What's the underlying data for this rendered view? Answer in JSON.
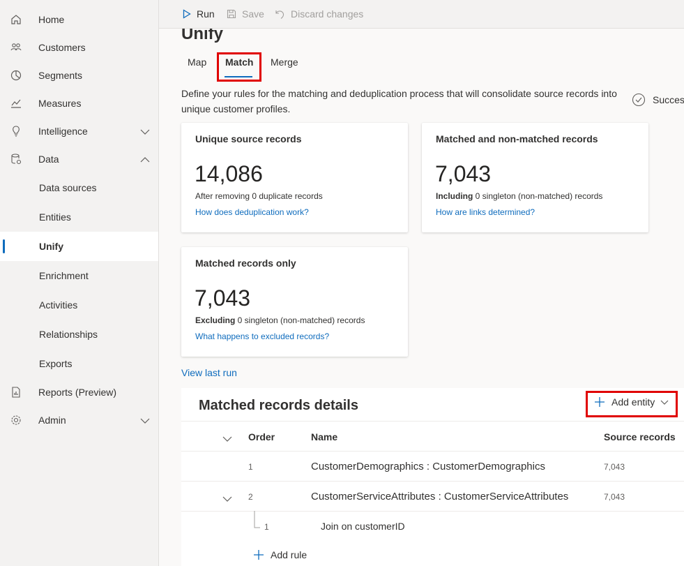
{
  "sidebar": {
    "items": [
      {
        "label": "Home",
        "icon": "home-icon"
      },
      {
        "label": "Customers",
        "icon": "customers-icon"
      },
      {
        "label": "Segments",
        "icon": "segments-icon"
      },
      {
        "label": "Measures",
        "icon": "measures-icon"
      },
      {
        "label": "Intelligence",
        "icon": "intelligence-icon"
      },
      {
        "label": "Data",
        "icon": "data-icon"
      }
    ],
    "data_children": [
      "Data sources",
      "Entities",
      "Unify",
      "Enrichment",
      "Activities",
      "Relationships",
      "Exports"
    ],
    "reports": "Reports (Preview)",
    "admin": "Admin"
  },
  "toolbar": {
    "run": "Run",
    "save": "Save",
    "discard": "Discard changes"
  },
  "page": {
    "title": "Unify",
    "tabs": [
      "Map",
      "Match",
      "Merge"
    ],
    "active_tab": "Match",
    "description": "Define your rules for the matching and deduplication process that will consolidate source records into unique customer profiles.",
    "status": "Success"
  },
  "cards": [
    {
      "title": "Unique source records",
      "value": "14,086",
      "sub": "After removing 0 duplicate records",
      "link": "How does deduplication work?"
    },
    {
      "title": "Matched and non-matched records",
      "value": "7,043",
      "sub_bold": "Including",
      "sub": " 0 singleton (non-matched) records",
      "link": "How are links determined?"
    },
    {
      "title": "Matched records only",
      "value": "7,043",
      "sub_bold": "Excluding",
      "sub": " 0 singleton (non-matched) records",
      "link": "What happens to excluded records?"
    }
  ],
  "view_last_run": "View last run",
  "details": {
    "title": "Matched records details",
    "add_entity": "Add entity",
    "columns": {
      "order": "Order",
      "name": "Name",
      "source": "Source records"
    },
    "rows": [
      {
        "order": "1",
        "name": "CustomerDemographics : CustomerDemographics",
        "source": "7,043"
      },
      {
        "order": "2",
        "name": "CustomerServiceAttributes : CustomerServiceAttributes",
        "source": "7,043"
      }
    ],
    "rule": {
      "order": "1",
      "name": "Join on customerID"
    },
    "add_rule": "Add rule"
  },
  "colors": {
    "accent": "#0f6cbd",
    "highlight": "#e00000"
  }
}
